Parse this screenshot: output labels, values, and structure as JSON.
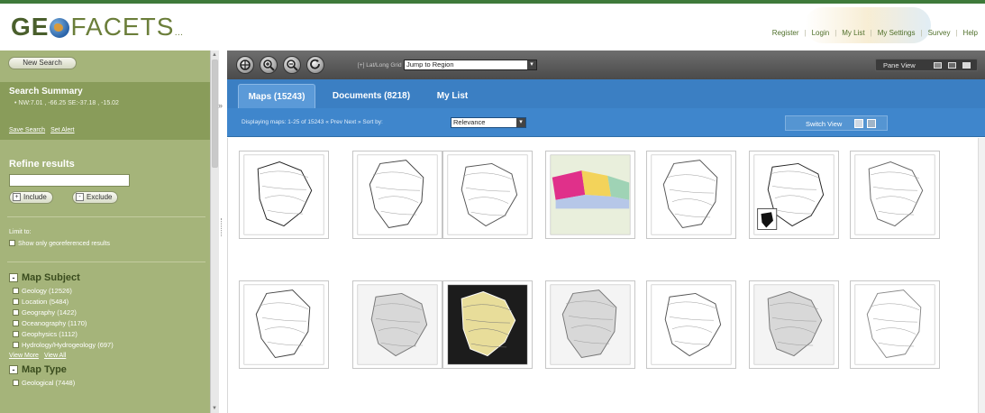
{
  "header": {
    "logo_prefix": "GE",
    "logo_suffix": "FACETS",
    "logo_mark": "…",
    "links": [
      "Register",
      "Login",
      "My List",
      "My Settings",
      "Survey",
      "Help"
    ],
    "separator": "|"
  },
  "sidebar": {
    "new_search_label": "New Search",
    "summary_title": "Search Summary",
    "summary_coords": "• NW:7.01 , -66.25 SE:-37.18 , -15.02",
    "save_search_label": "Save Search",
    "set_alert_label": "Set Alert",
    "refine_title": "Refine results",
    "include_label": "Include",
    "exclude_label": "Exclude",
    "plus_sign": "+",
    "minus_sign": "-",
    "limit_label": "Limit to:",
    "georef_label": "Show only georeferenced results",
    "map_subject": {
      "title": "Map Subject",
      "items": [
        "Geology (12526)",
        "Location (5484)",
        "Geography (1422)",
        "Oceanography (1170)",
        "Geophysics (1112)",
        "Hydrology/Hydrogeology (697)"
      ],
      "view_more": "View More",
      "view_all": "View All"
    },
    "map_type": {
      "title": "Map Type",
      "items": [
        "Geological (7448)"
      ]
    },
    "scroll_up": "▲",
    "scroll_down": "▼",
    "collapse_arrow": "›"
  },
  "toolbar": {
    "lat_label": "[+] Lat/Long Grid",
    "region_select": "Jump to Region",
    "pane_view_label": "Pane View",
    "select_arrow": "▾"
  },
  "tabs": [
    {
      "label": "Maps (15243)",
      "active": true
    },
    {
      "label": "Documents (8218)",
      "active": false
    },
    {
      "label": "My List",
      "active": false
    }
  ],
  "results": {
    "display_text": "Displaying maps: 1-25 of 15243  « Prev  Next »  Sort by:",
    "sort_value": "Relevance",
    "switch_view_label": "Switch View"
  },
  "thumbnails": [
    {
      "id": "map-1",
      "style": "line",
      "accent": "#222222"
    },
    {
      "id": "map-2",
      "style": "line",
      "accent": "#444444"
    },
    {
      "id": "map-3",
      "style": "outline",
      "accent": "#555555"
    },
    {
      "id": "map-4",
      "style": "color",
      "accent": "#e0308a"
    },
    {
      "id": "map-5",
      "style": "outline",
      "accent": "#555555"
    },
    {
      "id": "map-6",
      "style": "outline-inset",
      "accent": "#222222"
    },
    {
      "id": "map-7",
      "style": "line",
      "accent": "#666666"
    },
    {
      "id": "map-8",
      "style": "outline",
      "accent": "#444444"
    },
    {
      "id": "map-9",
      "style": "gray",
      "accent": "#9a9a9a"
    },
    {
      "id": "map-10",
      "style": "dark",
      "accent": "#f0e6a0"
    },
    {
      "id": "map-11",
      "style": "gray",
      "accent": "#aaaaaa"
    },
    {
      "id": "map-12",
      "style": "line",
      "accent": "#555555"
    },
    {
      "id": "map-13",
      "style": "gray",
      "accent": "#9c9c9c"
    },
    {
      "id": "map-14",
      "style": "line",
      "accent": "#888888"
    }
  ],
  "colors": {
    "sidebar_bg": "#a5b47a",
    "summary_bg": "#899c5a",
    "tabbar_bg": "#3b7fc3",
    "toolbar_bg": "#555555"
  }
}
